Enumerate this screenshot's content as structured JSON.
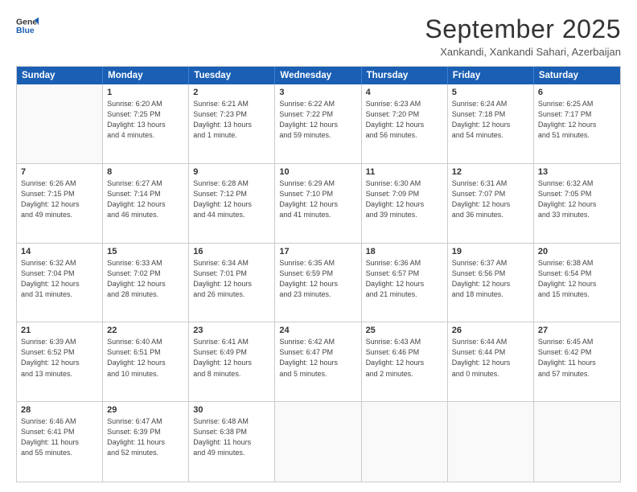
{
  "logo": {
    "line1": "General",
    "line2": "Blue"
  },
  "title": "September 2025",
  "subtitle": "Xankandi, Xankandi Sahari, Azerbaijan",
  "header_days": [
    "Sunday",
    "Monday",
    "Tuesday",
    "Wednesday",
    "Thursday",
    "Friday",
    "Saturday"
  ],
  "weeks": [
    [
      {
        "day": "",
        "lines": []
      },
      {
        "day": "1",
        "lines": [
          "Sunrise: 6:20 AM",
          "Sunset: 7:25 PM",
          "Daylight: 13 hours",
          "and 4 minutes."
        ]
      },
      {
        "day": "2",
        "lines": [
          "Sunrise: 6:21 AM",
          "Sunset: 7:23 PM",
          "Daylight: 13 hours",
          "and 1 minute."
        ]
      },
      {
        "day": "3",
        "lines": [
          "Sunrise: 6:22 AM",
          "Sunset: 7:22 PM",
          "Daylight: 12 hours",
          "and 59 minutes."
        ]
      },
      {
        "day": "4",
        "lines": [
          "Sunrise: 6:23 AM",
          "Sunset: 7:20 PM",
          "Daylight: 12 hours",
          "and 56 minutes."
        ]
      },
      {
        "day": "5",
        "lines": [
          "Sunrise: 6:24 AM",
          "Sunset: 7:18 PM",
          "Daylight: 12 hours",
          "and 54 minutes."
        ]
      },
      {
        "day": "6",
        "lines": [
          "Sunrise: 6:25 AM",
          "Sunset: 7:17 PM",
          "Daylight: 12 hours",
          "and 51 minutes."
        ]
      }
    ],
    [
      {
        "day": "7",
        "lines": [
          "Sunrise: 6:26 AM",
          "Sunset: 7:15 PM",
          "Daylight: 12 hours",
          "and 49 minutes."
        ]
      },
      {
        "day": "8",
        "lines": [
          "Sunrise: 6:27 AM",
          "Sunset: 7:14 PM",
          "Daylight: 12 hours",
          "and 46 minutes."
        ]
      },
      {
        "day": "9",
        "lines": [
          "Sunrise: 6:28 AM",
          "Sunset: 7:12 PM",
          "Daylight: 12 hours",
          "and 44 minutes."
        ]
      },
      {
        "day": "10",
        "lines": [
          "Sunrise: 6:29 AM",
          "Sunset: 7:10 PM",
          "Daylight: 12 hours",
          "and 41 minutes."
        ]
      },
      {
        "day": "11",
        "lines": [
          "Sunrise: 6:30 AM",
          "Sunset: 7:09 PM",
          "Daylight: 12 hours",
          "and 39 minutes."
        ]
      },
      {
        "day": "12",
        "lines": [
          "Sunrise: 6:31 AM",
          "Sunset: 7:07 PM",
          "Daylight: 12 hours",
          "and 36 minutes."
        ]
      },
      {
        "day": "13",
        "lines": [
          "Sunrise: 6:32 AM",
          "Sunset: 7:05 PM",
          "Daylight: 12 hours",
          "and 33 minutes."
        ]
      }
    ],
    [
      {
        "day": "14",
        "lines": [
          "Sunrise: 6:32 AM",
          "Sunset: 7:04 PM",
          "Daylight: 12 hours",
          "and 31 minutes."
        ]
      },
      {
        "day": "15",
        "lines": [
          "Sunrise: 6:33 AM",
          "Sunset: 7:02 PM",
          "Daylight: 12 hours",
          "and 28 minutes."
        ]
      },
      {
        "day": "16",
        "lines": [
          "Sunrise: 6:34 AM",
          "Sunset: 7:01 PM",
          "Daylight: 12 hours",
          "and 26 minutes."
        ]
      },
      {
        "day": "17",
        "lines": [
          "Sunrise: 6:35 AM",
          "Sunset: 6:59 PM",
          "Daylight: 12 hours",
          "and 23 minutes."
        ]
      },
      {
        "day": "18",
        "lines": [
          "Sunrise: 6:36 AM",
          "Sunset: 6:57 PM",
          "Daylight: 12 hours",
          "and 21 minutes."
        ]
      },
      {
        "day": "19",
        "lines": [
          "Sunrise: 6:37 AM",
          "Sunset: 6:56 PM",
          "Daylight: 12 hours",
          "and 18 minutes."
        ]
      },
      {
        "day": "20",
        "lines": [
          "Sunrise: 6:38 AM",
          "Sunset: 6:54 PM",
          "Daylight: 12 hours",
          "and 15 minutes."
        ]
      }
    ],
    [
      {
        "day": "21",
        "lines": [
          "Sunrise: 6:39 AM",
          "Sunset: 6:52 PM",
          "Daylight: 12 hours",
          "and 13 minutes."
        ]
      },
      {
        "day": "22",
        "lines": [
          "Sunrise: 6:40 AM",
          "Sunset: 6:51 PM",
          "Daylight: 12 hours",
          "and 10 minutes."
        ]
      },
      {
        "day": "23",
        "lines": [
          "Sunrise: 6:41 AM",
          "Sunset: 6:49 PM",
          "Daylight: 12 hours",
          "and 8 minutes."
        ]
      },
      {
        "day": "24",
        "lines": [
          "Sunrise: 6:42 AM",
          "Sunset: 6:47 PM",
          "Daylight: 12 hours",
          "and 5 minutes."
        ]
      },
      {
        "day": "25",
        "lines": [
          "Sunrise: 6:43 AM",
          "Sunset: 6:46 PM",
          "Daylight: 12 hours",
          "and 2 minutes."
        ]
      },
      {
        "day": "26",
        "lines": [
          "Sunrise: 6:44 AM",
          "Sunset: 6:44 PM",
          "Daylight: 12 hours",
          "and 0 minutes."
        ]
      },
      {
        "day": "27",
        "lines": [
          "Sunrise: 6:45 AM",
          "Sunset: 6:42 PM",
          "Daylight: 11 hours",
          "and 57 minutes."
        ]
      }
    ],
    [
      {
        "day": "28",
        "lines": [
          "Sunrise: 6:46 AM",
          "Sunset: 6:41 PM",
          "Daylight: 11 hours",
          "and 55 minutes."
        ]
      },
      {
        "day": "29",
        "lines": [
          "Sunrise: 6:47 AM",
          "Sunset: 6:39 PM",
          "Daylight: 11 hours",
          "and 52 minutes."
        ]
      },
      {
        "day": "30",
        "lines": [
          "Sunrise: 6:48 AM",
          "Sunset: 6:38 PM",
          "Daylight: 11 hours",
          "and 49 minutes."
        ]
      },
      {
        "day": "",
        "lines": []
      },
      {
        "day": "",
        "lines": []
      },
      {
        "day": "",
        "lines": []
      },
      {
        "day": "",
        "lines": []
      }
    ]
  ]
}
